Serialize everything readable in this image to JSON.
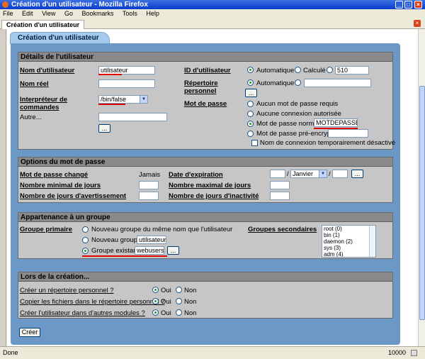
{
  "window": {
    "title": "Création d'un utilisateur - Mozilla Firefox"
  },
  "menu": [
    "File",
    "Edit",
    "View",
    "Go",
    "Bookmarks",
    "Tools",
    "Help"
  ],
  "browser_tab": {
    "label": "Création d'un utilisateur"
  },
  "page_tab": "Création d'un utilisateur",
  "details": {
    "header": "Détails de l'utilisateur",
    "username_label": "Nom d'utilisateur",
    "username_value": "utilisateur",
    "realname_label": "Nom réel",
    "realname_value": "",
    "shell_label": "Interpréteur de commandes",
    "shell_value": "/bin/false",
    "other_label": "Autre...",
    "other_value": "",
    "uid_label": "ID d'utilisateur",
    "uid_auto": "Automatique",
    "uid_calc": "Calculé",
    "uid_value": "510",
    "homedir_label": "Répertoire personnel",
    "homedir_auto": "Automatique",
    "homedir_value": "",
    "password_label": "Mot de passe",
    "pw_none": "Aucun mot de passe requis",
    "pw_noconn": "Aucune connexion autorisée",
    "pw_normal": "Mot de passe normal",
    "pw_normal_value": "MOTDEPASSE",
    "pw_pre": "Mot de passe pré-encrypté",
    "pw_pre_value": "",
    "pw_disabled": "Nom de connexion temporairement désactivé",
    "browse": "..."
  },
  "pwopts": {
    "header": "Options du mot de passe",
    "changed_label": "Mot de passe changé",
    "changed_value": "Jamais",
    "expire_label": "Date d'expiration",
    "expire_month": "Janvier",
    "expire_day": "",
    "expire_year": "",
    "min_label": "Nombre minimal de jours",
    "min_value": "",
    "max_label": "Nombre maximal de jours",
    "max_value": "",
    "warn_label": "Nombre de jours d'avertissement",
    "warn_value": "",
    "inact_label": "Nombre de jours d'inactivité",
    "inact_value": ""
  },
  "groups": {
    "header": "Appartenance à un groupe",
    "primary_label": "Groupe primaire",
    "same_name": "Nouveau groupe du même nom que l'utilisateur",
    "new_group": "Nouveau groupe",
    "new_group_value": "utilisateur",
    "existing": "Groupe existant",
    "existing_value": "webusers",
    "secondary_label": "Groupes secondaires",
    "secondary_options": [
      "root (0)",
      "bin (1)",
      "daemon (2)",
      "sys (3)",
      "adm (4)"
    ]
  },
  "creation": {
    "header": "Lors de la création...",
    "q1": "Créer un répertoire personnel ?",
    "q2": "Copier les fichiers dans le répertoire personnel ?",
    "q3": "Créer l'utilisateur dans d'autres modules ?",
    "yes": "Oui",
    "no": "Non"
  },
  "submit": "Créer",
  "status": {
    "text": "Done",
    "counter": "10000"
  }
}
